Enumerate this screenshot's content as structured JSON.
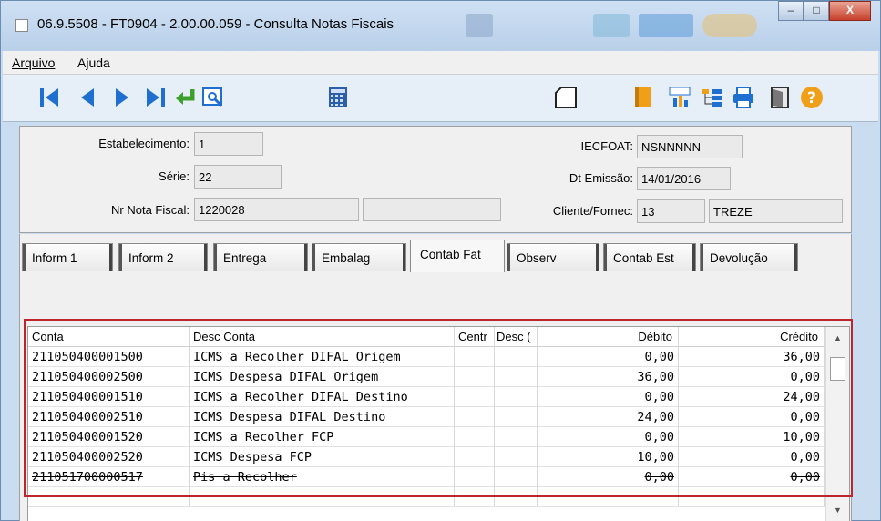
{
  "window": {
    "title": "06.9.5508 - FT0904 - 2.00.00.059 - Consulta Notas Fiscais",
    "controls": [
      "minimize",
      "maximize",
      "close"
    ]
  },
  "menu": {
    "items": [
      "Arquivo",
      "Ajuda"
    ]
  },
  "toolbar": {
    "left_icons": [
      "first-record-icon",
      "previous-record-icon",
      "next-record-icon",
      "last-record-icon",
      "goto-icon",
      "search-icon",
      "calculator-icon"
    ],
    "right_icons": [
      "new-document-icon",
      "book-icon",
      "chart-icon",
      "tree-icon",
      "print-icon",
      "exit-icon",
      "help-icon"
    ],
    "accent": "#1f6fd0"
  },
  "header": {
    "estabelecimento_label": "Estabelecimento:",
    "estabelecimento_value": "1",
    "serie_label": "Série:",
    "serie_value": "22",
    "nr_nota_label": "Nr Nota Fiscal:",
    "nr_nota_value": "1220028",
    "nr_nota_extra": "",
    "iecfoat_label": "IECFOAT:",
    "iecfoat_value": "NSNNNNN",
    "dt_emissao_label": "Dt Emissão:",
    "dt_emissao_value": "14/01/2016",
    "cliente_label": "Cliente/Fornec:",
    "cliente_code": "13",
    "cliente_name": "TREZE"
  },
  "tabs": [
    {
      "label": "Inform 1"
    },
    {
      "label": "Inform 2"
    },
    {
      "label": "Entrega"
    },
    {
      "label": "Embalag"
    },
    {
      "label": "Contab Fat",
      "active": true
    },
    {
      "label": "Observ"
    },
    {
      "label": "Contab Est"
    },
    {
      "label": "Devolução"
    }
  ],
  "grid": {
    "columns": [
      "Conta",
      "Desc Conta",
      "Centr",
      "Desc (",
      "Débito",
      "Crédito"
    ],
    "rows": [
      {
        "conta": "211050400001500",
        "desc": "ICMS a Recolher DIFAL Origem",
        "centr": "",
        "desc_c": "",
        "debito": "0,00",
        "credito": "36,00"
      },
      {
        "conta": "211050400002500",
        "desc": "ICMS Despesa DIFAL Origem",
        "centr": "",
        "desc_c": "",
        "debito": "36,00",
        "credito": "0,00"
      },
      {
        "conta": "211050400001510",
        "desc": "ICMS a Recolher DIFAL Destino",
        "centr": "",
        "desc_c": "",
        "debito": "0,00",
        "credito": "24,00"
      },
      {
        "conta": "211050400002510",
        "desc": "ICMS Despesa DIFAL Destino",
        "centr": "",
        "desc_c": "",
        "debito": "24,00",
        "credito": "0,00"
      },
      {
        "conta": "211050400001520",
        "desc": "ICMS a Recolher FCP",
        "centr": "",
        "desc_c": "",
        "debito": "0,00",
        "credito": "10,00"
      },
      {
        "conta": "211050400002520",
        "desc": "ICMS Despesa FCP",
        "centr": "",
        "desc_c": "",
        "debito": "10,00",
        "credito": "0,00"
      },
      {
        "conta": "211051700000517",
        "desc": "Pis a Recolher",
        "centr": "",
        "desc_c": "",
        "debito": "0,00",
        "credito": "0,00"
      }
    ]
  },
  "colors": {
    "highlight_border": "#c0242b",
    "title_bar": "#c9dcf0"
  }
}
